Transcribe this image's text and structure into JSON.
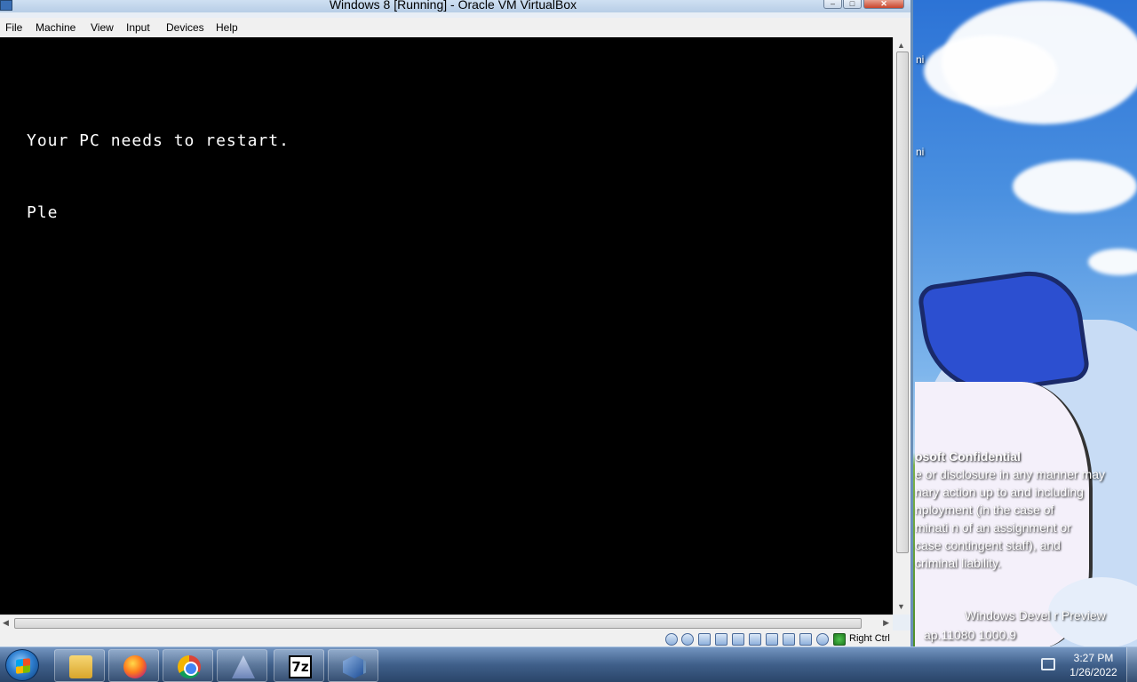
{
  "window": {
    "title": "Windows 8 [Running] - Oracle VM VirtualBox",
    "menu": [
      "File",
      "Machine",
      "View",
      "Input",
      "Devices",
      "Help"
    ]
  },
  "vm_screen": {
    "lines": [
      "Your PC needs to restart.",
      "Ple"
    ],
    "background": "#000000",
    "text_color": "#ffffff"
  },
  "statusbar": {
    "host_key": "Right Ctrl",
    "icons": [
      "hard-disk-icon",
      "optical-drive-icon",
      "audio-icon",
      "network-icon",
      "usb-icon",
      "shared-folders-icon",
      "display-icon",
      "video-capture-icon",
      "vm-icon",
      "cpu-icon",
      "mouse-integration-icon",
      "keyboard-capture-icon"
    ]
  },
  "desktop": {
    "edge_labels": [
      "ni",
      "ni"
    ],
    "watermark": {
      "title": "osoft Confidential",
      "lines": [
        "e or disclosure in any manner may",
        "nary action up to and including",
        "nployment (in the case of",
        "minati n of an assignment or",
        "case   contingent staff), and",
        "criminal liability."
      ],
      "build_line1": "Windows Devel    r Preview",
      "build_line2": "ap.11080    1000.9         "
    }
  },
  "taskbar": {
    "apps": [
      "folder-icon",
      "firefox-icon",
      "chrome-icon",
      "alpha-app-icon",
      "7zip-icon",
      "virtualbox-icon"
    ],
    "sevenzip_label": "7z",
    "clock_time": "3:27 PM",
    "clock_date": "1/26/2022"
  }
}
